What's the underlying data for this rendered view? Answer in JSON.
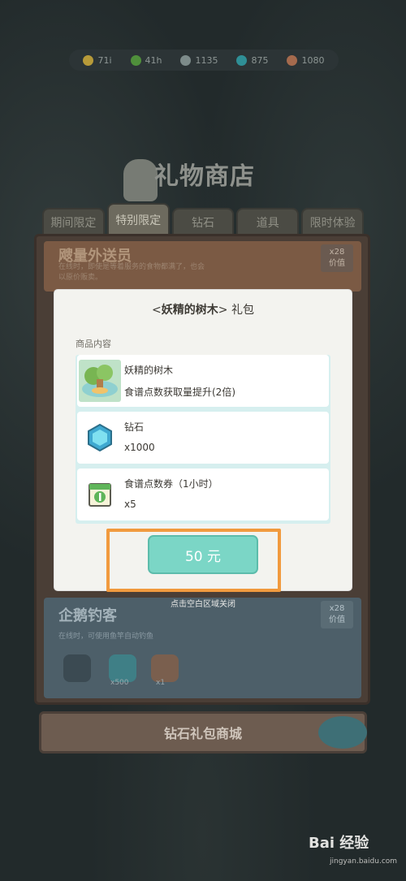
{
  "resources": [
    {
      "icon": "gold-coin-icon",
      "value": "71i",
      "color": "#b79a39"
    },
    {
      "icon": "leaf-icon",
      "value": "41h",
      "color": "#4f8f3b"
    },
    {
      "icon": "swirl-icon",
      "value": "1135",
      "color": "#7d8b8a"
    },
    {
      "icon": "gem-icon",
      "value": "875",
      "color": "#2f8f96"
    },
    {
      "icon": "fruit-icon",
      "value": "1080",
      "color": "#a56a4d"
    }
  ],
  "shop": {
    "title": "礼物商店",
    "tabs": [
      "期间限定",
      "特别限定",
      "钻石",
      "道具",
      "限时体验"
    ],
    "active_tab": "特别限定"
  },
  "banners": {
    "top": {
      "title": "飕量外送员",
      "desc": "在线时，即使是等着服务的食物都满了，也会以原价贩卖。",
      "badge_value": "x28",
      "badge_unit": "价值"
    },
    "bottom": {
      "title": "企鹅钓客",
      "desc": "在线时，可使用鱼竿自动钓鱼",
      "badge_value": "x28",
      "badge_unit": "价值",
      "rewards": [
        "x500",
        "x1"
      ]
    }
  },
  "popup": {
    "title_prefix": "<",
    "title_name": "妖精的树木",
    "title_suffix": "> 礼包",
    "section_label": "商品内容",
    "items": [
      {
        "name": "妖精的树木",
        "desc": "食谱点数获取量提升(2倍)",
        "icon": "fairy-tree-icon"
      },
      {
        "name": "钻石",
        "desc": "x1000",
        "icon": "diamond-icon"
      },
      {
        "name": "食谱点数券（1小时）",
        "desc": "x5",
        "icon": "recipe-ticket-icon"
      }
    ],
    "price": "50 元",
    "close_hint": "点击空白区域关闭"
  },
  "diamond_shop": {
    "label": "钻石礼包商城"
  },
  "watermark": {
    "brand": "Bai 经验",
    "url": "jingyan.baidu.com"
  }
}
